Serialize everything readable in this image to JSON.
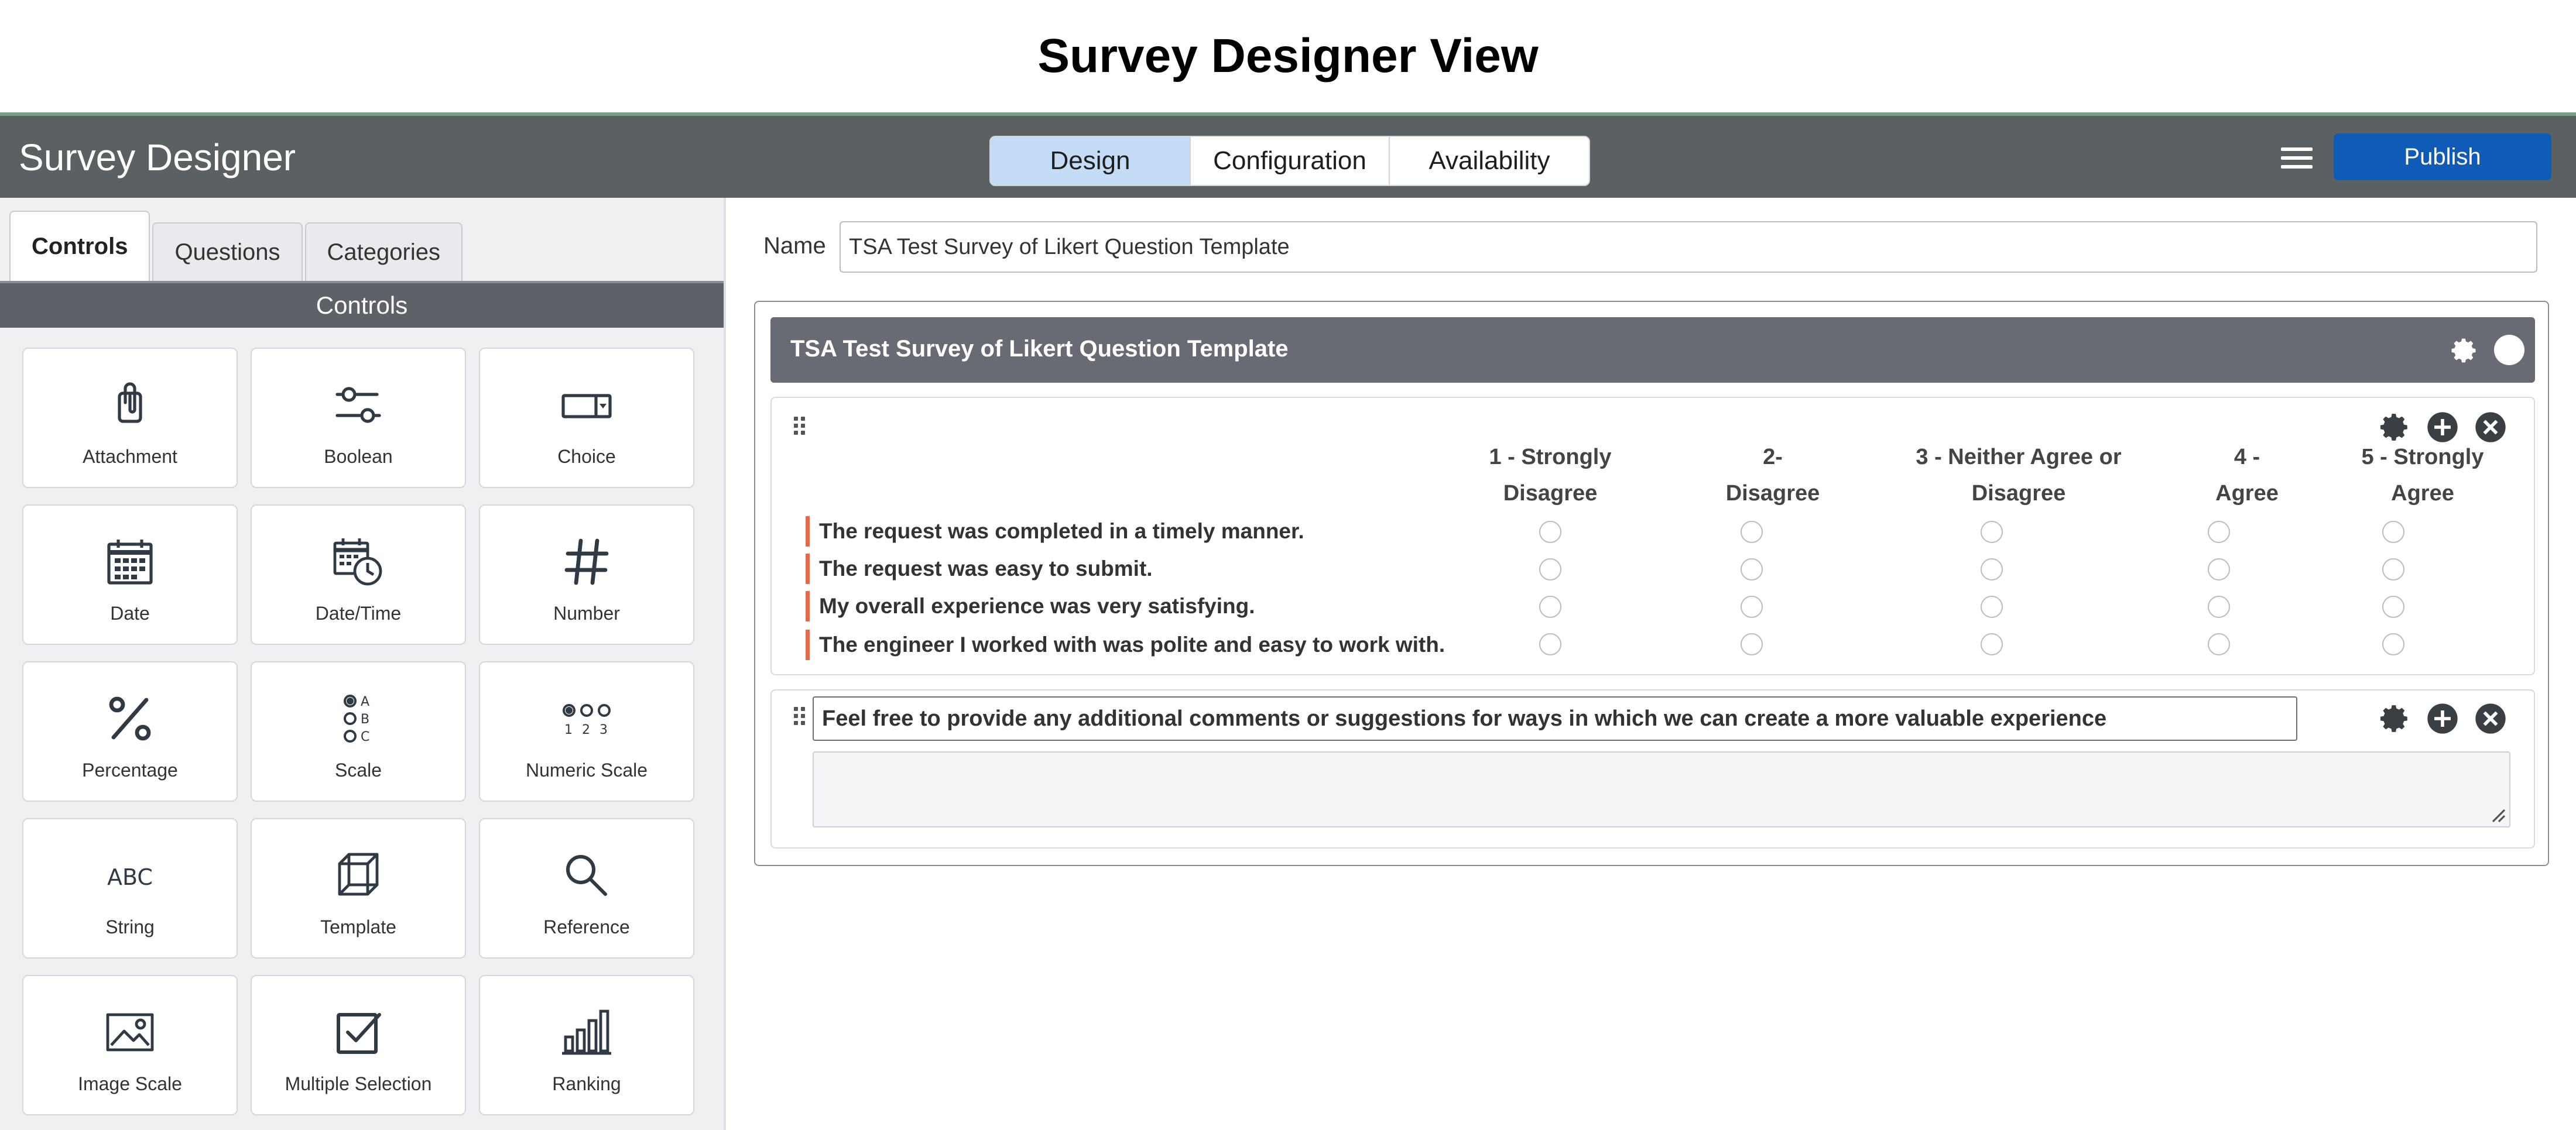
{
  "page_title": "Survey Designer View",
  "header": {
    "app_title": "Survey Designer",
    "tabs": [
      {
        "label": "Design",
        "active": true
      },
      {
        "label": "Configuration",
        "active": false
      },
      {
        "label": "Availability",
        "active": false
      }
    ],
    "publish_label": "Publish"
  },
  "sidebar": {
    "tabs": [
      {
        "label": "Controls",
        "active": true
      },
      {
        "label": "Questions",
        "active": false
      },
      {
        "label": "Categories",
        "active": false
      }
    ],
    "section_title": "Controls",
    "controls": [
      {
        "label": "Attachment",
        "icon": "paperclip-icon"
      },
      {
        "label": "Boolean",
        "icon": "toggle-sliders-icon"
      },
      {
        "label": "Choice",
        "icon": "dropdown-select-icon"
      },
      {
        "label": "Date",
        "icon": "calendar-icon"
      },
      {
        "label": "Date/Time",
        "icon": "calendar-clock-icon"
      },
      {
        "label": "Number",
        "icon": "hash-icon"
      },
      {
        "label": "Percentage",
        "icon": "percent-icon"
      },
      {
        "label": "Scale",
        "icon": "abc-scale-icon"
      },
      {
        "label": "Numeric Scale",
        "icon": "numeric-scale-icon"
      },
      {
        "label": "String",
        "icon": "abc-text-icon"
      },
      {
        "label": "Template",
        "icon": "cube-icon"
      },
      {
        "label": "Reference",
        "icon": "magnifier-icon"
      },
      {
        "label": "Image Scale",
        "icon": "image-icon"
      },
      {
        "label": "Multiple Selection",
        "icon": "checkbox-icon"
      },
      {
        "label": "Ranking",
        "icon": "bar-ranking-icon"
      }
    ]
  },
  "main": {
    "name_label": "Name",
    "name_value": "TSA Test Survey of Likert Question Template",
    "survey": {
      "title": "TSA Test Survey of Likert Question Template",
      "likert": {
        "columns": [
          {
            "line1": "1 - Strongly",
            "line2": "Disagree"
          },
          {
            "line1": "2-",
            "line2": "Disagree"
          },
          {
            "line1": "3 - Neither Agree or",
            "line2": "Disagree"
          },
          {
            "line1": "4 -",
            "line2": "Agree"
          },
          {
            "line1": "5 - Strongly",
            "line2": "Agree"
          }
        ],
        "statements": [
          "The request was completed in a timely manner.",
          "The request was easy to submit.",
          "My overall experience was very satisfying.",
          "The engineer I worked with was polite and easy to work with."
        ]
      },
      "comment": {
        "title": "Feel free to provide any additional comments or suggestions for ways in which we can create a more valuable experience",
        "value": ""
      }
    }
  },
  "colors": {
    "header_bg": "#5b6063",
    "active_tab": "#c4dcf6",
    "publish_bg": "#0f5bb5",
    "section_header_bg": "#5e6268",
    "survey_header_bg": "#686b73",
    "required_marker": "#e06a4c"
  }
}
